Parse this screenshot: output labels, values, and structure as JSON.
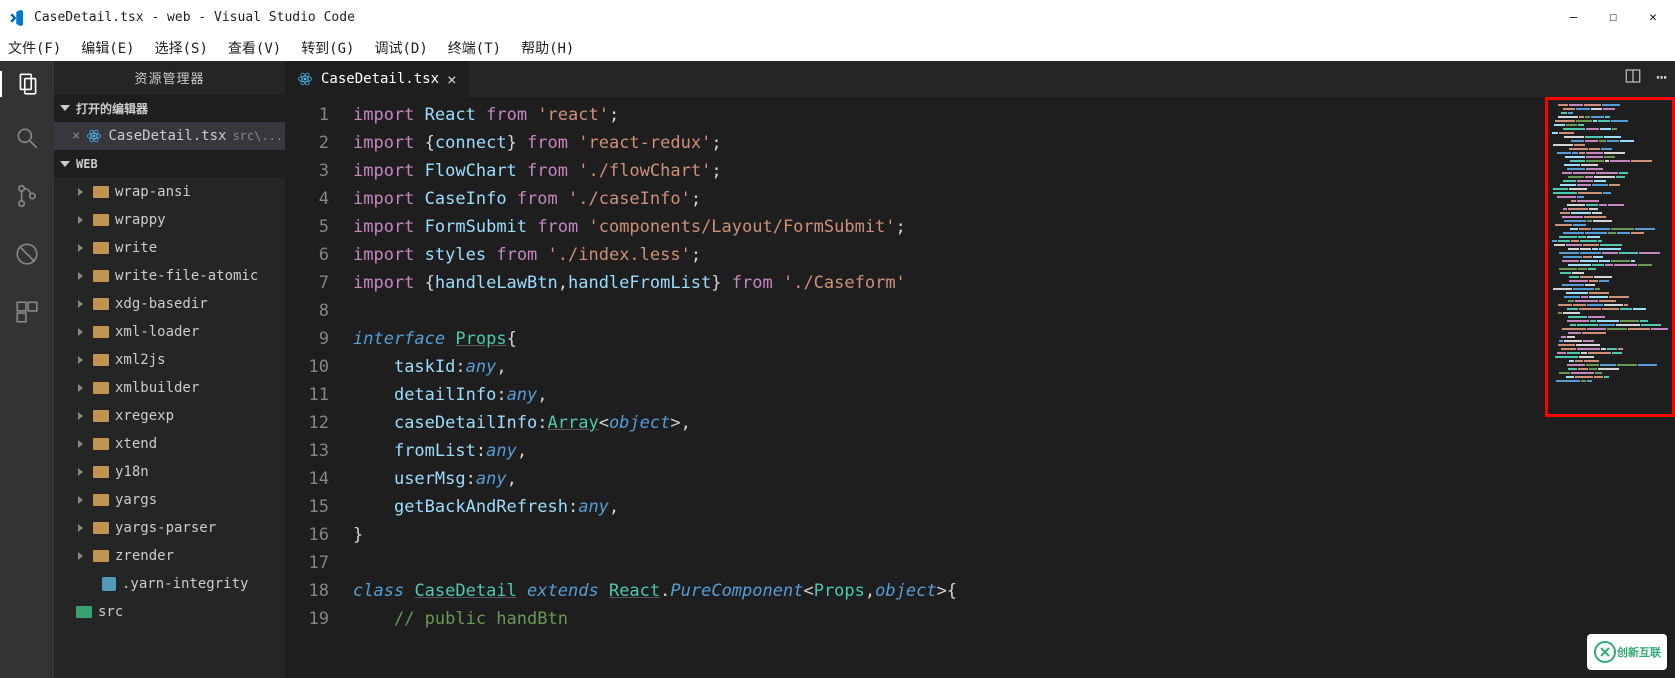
{
  "titlebar": {
    "title": "CaseDetail.tsx - web - Visual Studio Code"
  },
  "winbtns": {
    "min": "—",
    "max": "☐",
    "close": "✕"
  },
  "menu": [
    "文件(F)",
    "编辑(E)",
    "选择(S)",
    "查看(V)",
    "转到(G)",
    "调试(D)",
    "终端(T)",
    "帮助(H)"
  ],
  "explorer": {
    "title": "资源管理器",
    "openEditors": "打开的编辑器",
    "openFile": {
      "name": "CaseDetail.tsx",
      "hint": "src\\..."
    },
    "project": "WEB",
    "folders": [
      "wrap-ansi",
      "wrappy",
      "write",
      "write-file-atomic",
      "xdg-basedir",
      "xml-loader",
      "xml2js",
      "xmlbuilder",
      "xregexp",
      "xtend",
      "y18n",
      "yargs",
      "yargs-parser",
      "zrender"
    ],
    "file1": ".yarn-integrity",
    "srcFolder": "src"
  },
  "tab": {
    "name": "CaseDetail.tsx"
  },
  "code": {
    "lines": [
      1,
      2,
      3,
      4,
      5,
      6,
      7,
      8,
      9,
      10,
      11,
      12,
      13,
      14,
      15,
      16,
      17,
      18,
      19
    ]
  },
  "watermark": "创新互联"
}
